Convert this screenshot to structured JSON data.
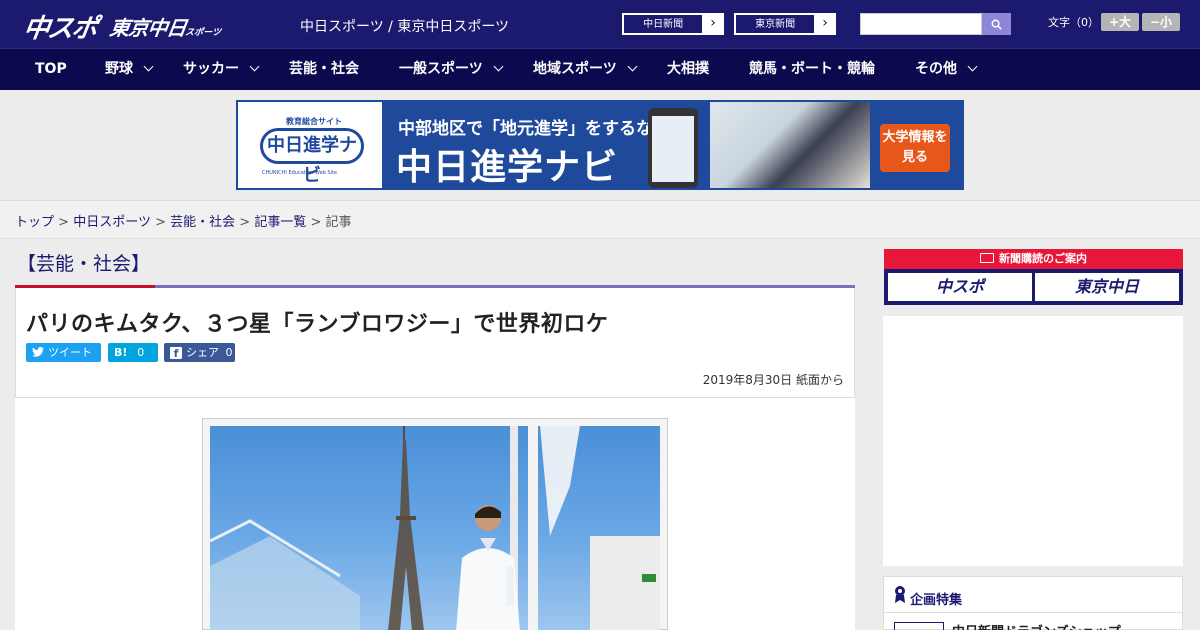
{
  "header": {
    "logo_chuspo": "中スポ",
    "logo_tokyo": "東京中日",
    "logo_tokyo_sub": "スポーツ",
    "site_names": "中日スポーツ / 東京中日スポーツ",
    "links": [
      {
        "label": "中日新聞"
      },
      {
        "label": "東京新聞"
      }
    ],
    "search_placeholder": "",
    "font_size_label": "文字（0）",
    "font_bigger": "+大",
    "font_smaller": "−小"
  },
  "nav": {
    "items": [
      {
        "label": "TOP",
        "has_menu": false
      },
      {
        "label": "野球",
        "has_menu": true
      },
      {
        "label": "サッカー",
        "has_menu": true
      },
      {
        "label": "芸能・社会",
        "has_menu": false
      },
      {
        "label": "一般スポーツ",
        "has_menu": true
      },
      {
        "label": "地域スポーツ",
        "has_menu": true
      },
      {
        "label": "大相撲",
        "has_menu": false
      },
      {
        "label": "競馬・ボート・競輪",
        "has_menu": false
      },
      {
        "label": "その他",
        "has_menu": true
      }
    ]
  },
  "ad_banner": {
    "logo_small": "教育総合サイト",
    "logo_main": "中日進学ナビ",
    "logo_en": "CHUNICHI Education Web Site",
    "line1": "中部地区で「地元進学」をするなら",
    "line2": "中日進学ナビ",
    "cta": "大学情報を見る"
  },
  "breadcrumb": {
    "items": [
      "トップ",
      "中日スポーツ",
      "芸能・社会",
      "記事一覧"
    ],
    "current": "記事",
    "separator": ">"
  },
  "article": {
    "category": "【芸能・社会】",
    "title": "パリのキムタク、３つ星「ランブロワジー」で世界初ロケ",
    "share": {
      "tweet": "ツイート",
      "hatena_count": "0",
      "facebook_label": "シェア",
      "facebook_count": "0"
    },
    "date": "2019年8月30日 紙面から"
  },
  "sidebar": {
    "subscribe_title": "新聞購読のご案内",
    "subscribe_buttons": [
      "中スポ",
      "東京中日"
    ],
    "feature_title": "企画特集",
    "feature_item": "中日新聞ドラゴンズショップ"
  },
  "colors": {
    "header_bg": "#1c1a6e",
    "nav_bg": "#0c0a4e",
    "accent_red": "#c8102e",
    "accent_purple": "#7b6fc0",
    "twitter": "#1da1f2",
    "hatena": "#00a4de",
    "facebook": "#3b5998"
  }
}
